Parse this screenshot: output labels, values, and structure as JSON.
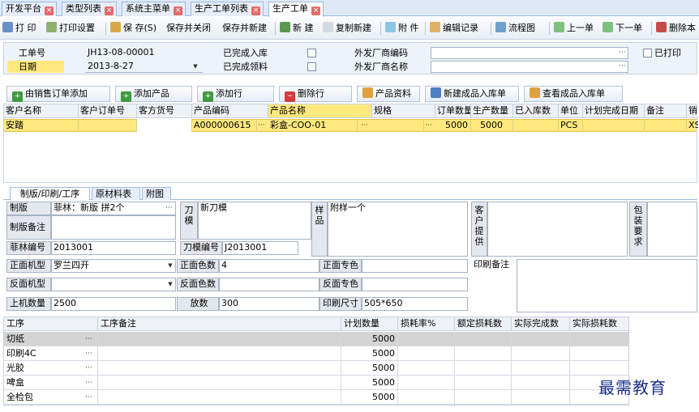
{
  "tabs": [
    {
      "label": "开发平台"
    },
    {
      "label": "类型列表"
    },
    {
      "label": "系统主菜单"
    },
    {
      "label": "生产工单列表"
    },
    {
      "label": "生产工单"
    }
  ],
  "toolbar": {
    "print": "打 印",
    "print_settings": "打印设置",
    "save": "保 存(S)",
    "save_close": "保存并关闭",
    "save_new": "保存并新建",
    "new": "新 建",
    "copy_new": "复制新建",
    "attachment": "附 件",
    "edit_log": "编辑记录",
    "flowchart": "流程图",
    "prev": "上一单",
    "next": "下一单",
    "delete": "删除本"
  },
  "header": {
    "order_no_label": "工单号",
    "order_no": "JH13-08-00001",
    "date_label": "日期",
    "date": "2013-8-27",
    "done_in_label": "已完成入库",
    "done_pick_label": "已完成领料",
    "vendor_code_label": "外发厂商编码",
    "vendor_name_label": "外发厂商名称",
    "printed_label": "已打印"
  },
  "buttons": {
    "from_sales": "由销售订单添加",
    "add_product": "添加产品",
    "add_row": "添加行",
    "delete_row": "删除行",
    "product_info": "产品资料",
    "new_inbound": "新建成品入库单",
    "view_inbound": "查看成品入库单"
  },
  "grid": {
    "headers": [
      "客户名称",
      "客户订单号",
      "客方货号",
      "产品编码",
      "产品名称",
      "规格",
      "订单数量",
      "生产数量",
      "已入库数",
      "单位",
      "计划完成日期",
      "备注",
      "销"
    ],
    "row": {
      "customer": "安踏",
      "cust_order": "",
      "cust_item": "",
      "product_code": "A000000615",
      "product_name": "彩盒-COO-01",
      "spec": "",
      "order_qty": "5000",
      "prod_qty": "5000",
      "stored": "",
      "unit": "PCS",
      "plan_date": "",
      "remark": "",
      "sales": "XS"
    }
  },
  "subtabs": [
    "制版/印刷/工序",
    "原材料表",
    "附图"
  ],
  "prepress": {
    "plate_label": "制版",
    "plate_value": "菲林：新版 拼2个",
    "knife_label": "刀模",
    "knife_value": "新刀模",
    "sample_label": "样品",
    "sample_value": "附样一个",
    "customer_supply_label": "客户提供",
    "packing_label": "包装要求",
    "plate_remark_label": "制版备注",
    "film_no_label": "菲林编号",
    "film_no": "2013001",
    "knife_no_label": "刀模编号",
    "knife_no": "J2013001",
    "front_machine_label": "正面机型",
    "front_machine": "罗兰四开",
    "front_colors_label": "正面色数",
    "front_colors": "4",
    "front_spot_label": "正面专色",
    "back_machine_label": "反面机型",
    "back_colors_label": "反面色数",
    "back_spot_label": "反面专色",
    "print_remark_label": "印刷备注",
    "machine_qty_label": "上机数量",
    "machine_qty": "2500",
    "allowance_label": "放数",
    "allowance": "300",
    "print_size_label": "印刷尺寸",
    "print_size": "505*650"
  },
  "process": {
    "headers": [
      "工序",
      "工序备注",
      "计划数量",
      "损耗率%",
      "额定损耗数",
      "实际完成数",
      "实际损耗数"
    ],
    "rows": [
      {
        "name": "切纸",
        "qty": "5000"
      },
      {
        "name": "印刷4C",
        "qty": "5000"
      },
      {
        "name": "光胶",
        "qty": "5000"
      },
      {
        "name": "啤盒",
        "qty": "5000"
      },
      {
        "name": "全检包",
        "qty": "5000"
      }
    ]
  },
  "watermark": "最需教育"
}
